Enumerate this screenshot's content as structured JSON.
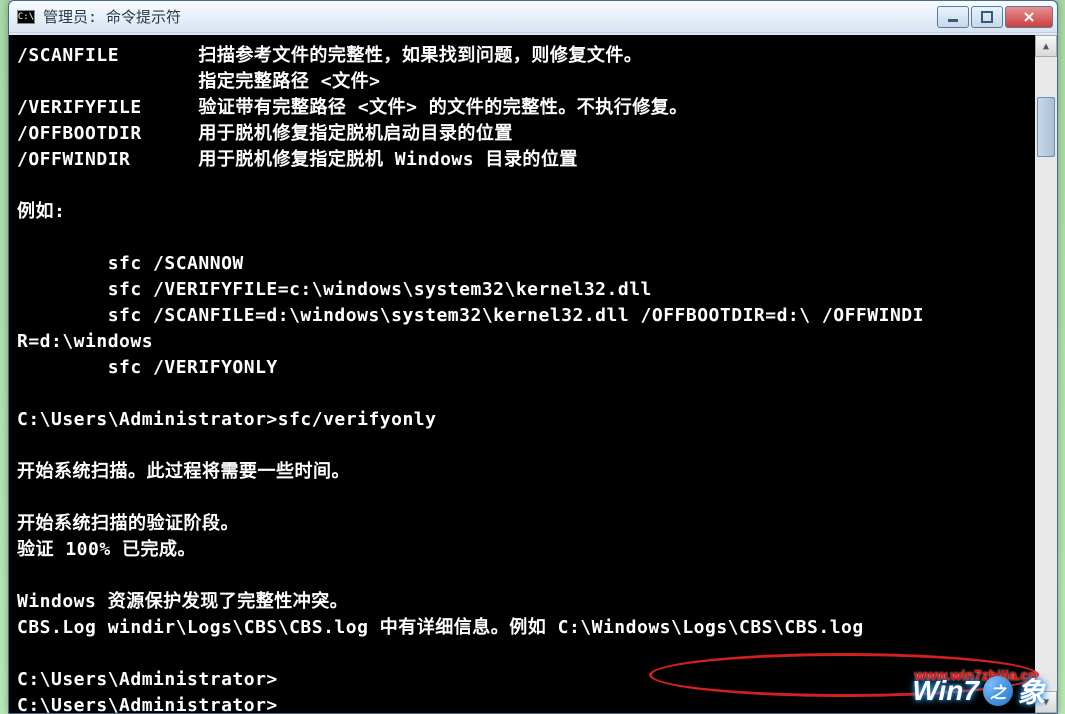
{
  "window": {
    "title": "管理员: 命令提示符"
  },
  "terminal": {
    "lines": [
      "/SCANFILE       扫描参考文件的完整性，如果找到问题，则修复文件。",
      "                指定完整路径 <文件>",
      "/VERIFYFILE     验证带有完整路径 <文件> 的文件的完整性。不执行修复。",
      "/OFFBOOTDIR     用于脱机修复指定脱机启动目录的位置",
      "/OFFWINDIR      用于脱机修复指定脱机 Windows 目录的位置",
      "",
      "例如:",
      "",
      "        sfc /SCANNOW",
      "        sfc /VERIFYFILE=c:\\windows\\system32\\kernel32.dll",
      "        sfc /SCANFILE=d:\\windows\\system32\\kernel32.dll /OFFBOOTDIR=d:\\ /OFFWINDI",
      "R=d:\\windows",
      "        sfc /VERIFYONLY",
      "",
      "C:\\Users\\Administrator>sfc/verifyonly",
      "",
      "开始系统扫描。此过程将需要一些时间。",
      "",
      "开始系统扫描的验证阶段。",
      "验证 100% 已完成。",
      "",
      "Windows 资源保护发现了完整性冲突。",
      "CBS.Log windir\\Logs\\CBS\\CBS.log 中有详细信息。例如 C:\\Windows\\Logs\\CBS\\CBS.log",
      "",
      "C:\\Users\\Administrator>",
      "C:\\Users\\Administrator>"
    ]
  },
  "watermark": {
    "url": "www.win7zhijia.cn",
    "logo_text_left": "Win7",
    "logo_text_right": "象"
  }
}
